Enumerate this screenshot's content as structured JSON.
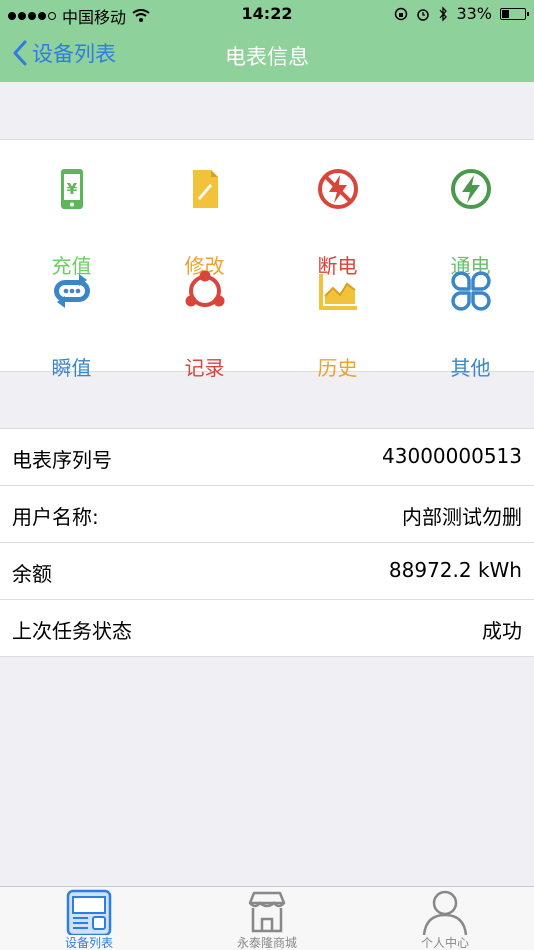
{
  "status_bar": {
    "carrier": "中国移动",
    "time": "14:22",
    "battery": "33%",
    "battery_level": 0.33
  },
  "nav": {
    "back_label": "设备列表",
    "title": "电表信息"
  },
  "actions": [
    {
      "label": "充值",
      "icon": "phone-yuan-icon",
      "color": "#6ccf62"
    },
    {
      "label": "修改",
      "icon": "edit-document-icon",
      "color": "#f0a128"
    },
    {
      "label": "断电",
      "icon": "power-off-icon",
      "color": "#d9453b"
    },
    {
      "label": "通电",
      "icon": "power-on-icon",
      "color": "#6abf6e"
    },
    {
      "label": "瞬值",
      "icon": "realtime-loop-icon",
      "color": "#3a86c8"
    },
    {
      "label": "记录",
      "icon": "records-icon",
      "color": "#d9453b"
    },
    {
      "label": "历史",
      "icon": "history-chart-icon",
      "color": "#f0a128"
    },
    {
      "label": "其他",
      "icon": "more-clover-icon",
      "color": "#3a86c8"
    }
  ],
  "info": [
    {
      "key": "电表序列号",
      "value": "43000000513"
    },
    {
      "key": "用户名称:",
      "value": "内部测试勿删"
    },
    {
      "key": "余额",
      "value": "88972.2 kWh"
    },
    {
      "key": "上次任务状态",
      "value": "成功"
    }
  ],
  "tabs": [
    {
      "label": "设备列表",
      "icon": "device-list-icon",
      "active": true
    },
    {
      "label": "永泰隆商城",
      "icon": "store-icon",
      "active": false
    },
    {
      "label": "个人中心",
      "icon": "person-icon",
      "active": false
    }
  ],
  "colors": {
    "nav_bg": "#8fd19a",
    "accent": "#2f7de1"
  }
}
